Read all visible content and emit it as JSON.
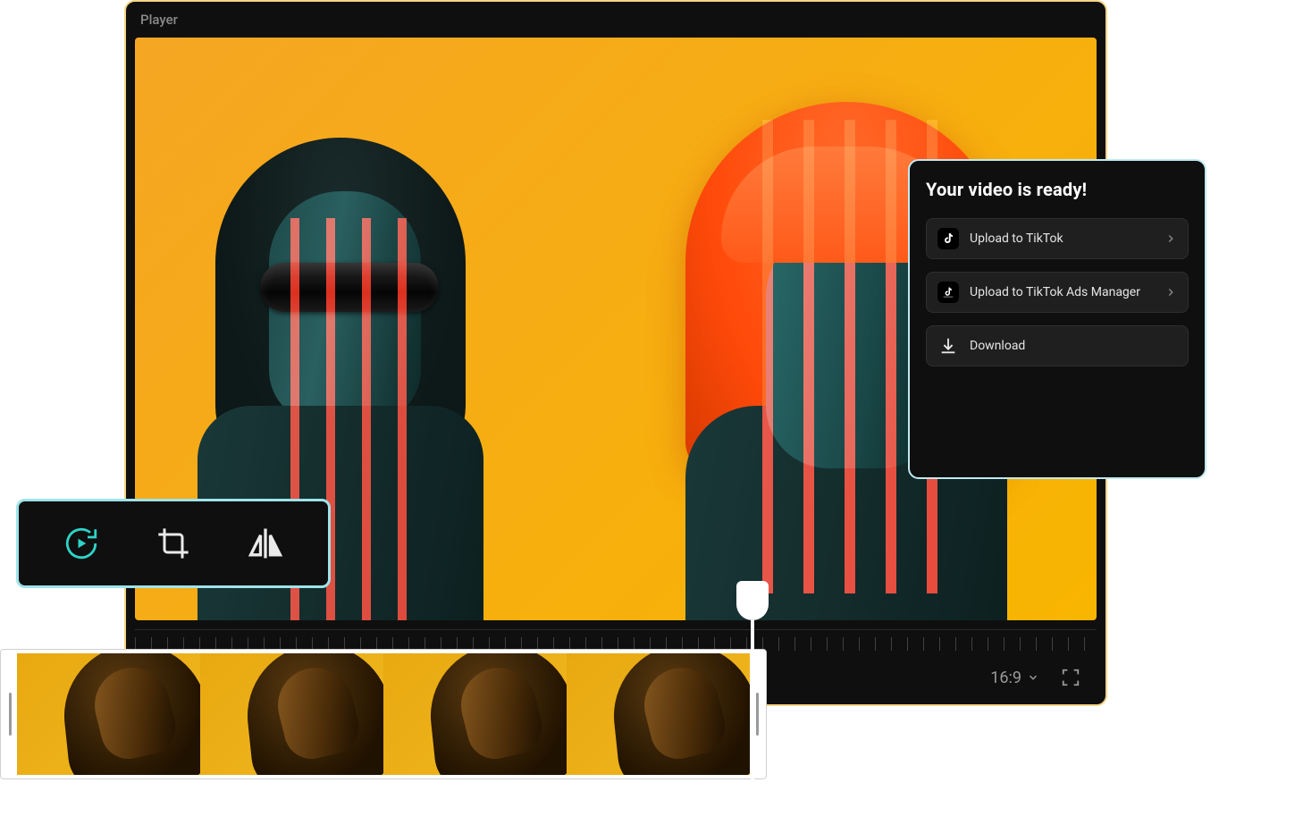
{
  "player": {
    "title": "Player",
    "aspect_ratio": "16:9"
  },
  "toolbar": {
    "tools": [
      {
        "name": "replay",
        "icon": "replay-icon",
        "active": true
      },
      {
        "name": "crop",
        "icon": "crop-icon",
        "active": false
      },
      {
        "name": "mirror",
        "icon": "mirror-icon",
        "active": false
      }
    ]
  },
  "ready_panel": {
    "heading": "Your video is ready!",
    "actions": [
      {
        "label": "Upload to TikTok",
        "icon": "tiktok-icon",
        "has_chevron": true
      },
      {
        "label": "Upload to TikTok Ads Manager",
        "icon": "tiktok-business-icon",
        "has_chevron": true
      },
      {
        "label": "Download",
        "icon": "download-icon",
        "has_chevron": false
      }
    ]
  },
  "filmstrip": {
    "thumbnail_count": 4
  }
}
